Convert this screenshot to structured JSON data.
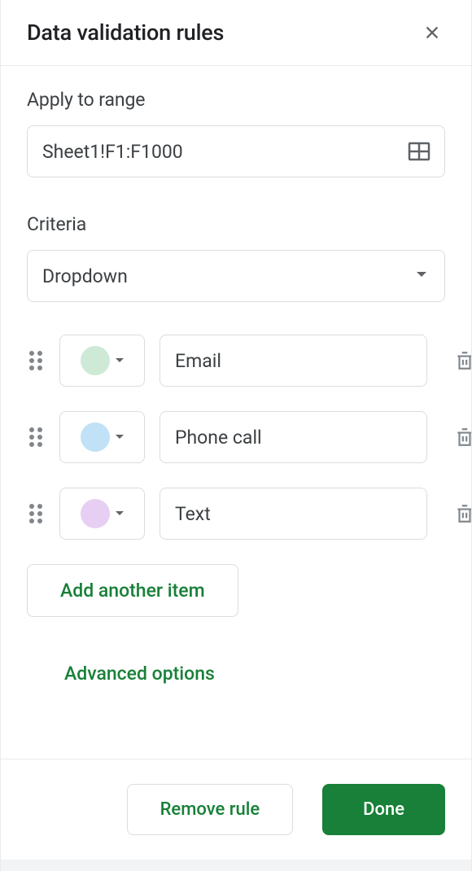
{
  "header": {
    "title": "Data validation rules"
  },
  "range": {
    "label": "Apply to range",
    "value": "Sheet1!F1:F1000"
  },
  "criteria": {
    "label": "Criteria",
    "selected": "Dropdown"
  },
  "options": [
    {
      "value": "Email",
      "color": "#ceead6"
    },
    {
      "value": "Phone call",
      "color": "#c0e1f6"
    },
    {
      "value": "Text",
      "color": "#e6cff2"
    }
  ],
  "buttons": {
    "add_item": "Add another item",
    "advanced": "Advanced options",
    "remove": "Remove rule",
    "done": "Done"
  }
}
